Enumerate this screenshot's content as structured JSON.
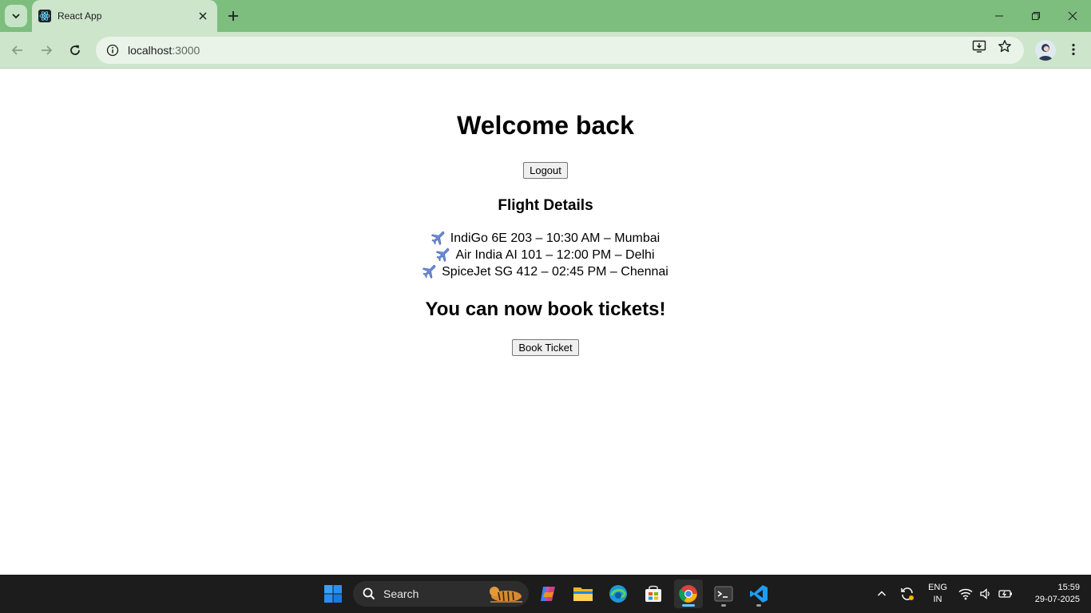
{
  "browser": {
    "tab_title": "React App",
    "url_host": "localhost",
    "url_port": ":3000"
  },
  "page": {
    "heading": "Welcome back",
    "logout_label": "Logout",
    "flights_heading": "Flight Details",
    "flights": [
      {
        "icon": "airplane-icon",
        "text": "IndiGo 6E 203 – 10:30 AM – Mumbai"
      },
      {
        "icon": "airplane-icon",
        "text": "Air India AI 101 – 12:00 PM – Delhi"
      },
      {
        "icon": "airplane-icon",
        "text": "SpiceJet SG 412 – 02:45 PM – Chennai"
      }
    ],
    "book_message": "You can now book tickets!",
    "book_label": "Book Ticket"
  },
  "taskbar": {
    "search_label": "Search",
    "lang_line1": "ENG",
    "lang_line2": "IN",
    "time": "15:59",
    "date": "29-07-2025",
    "pinned_apps": [
      "start-icon",
      "copilot-icon",
      "file-explorer-icon",
      "edge-icon",
      "store-icon",
      "chrome-icon",
      "terminal-icon",
      "vscode-icon"
    ]
  },
  "colors": {
    "tabbar_bg": "#7dbd7e",
    "toolbar_bg": "#cce5cb",
    "taskbar_bg": "#1c1c1c"
  }
}
